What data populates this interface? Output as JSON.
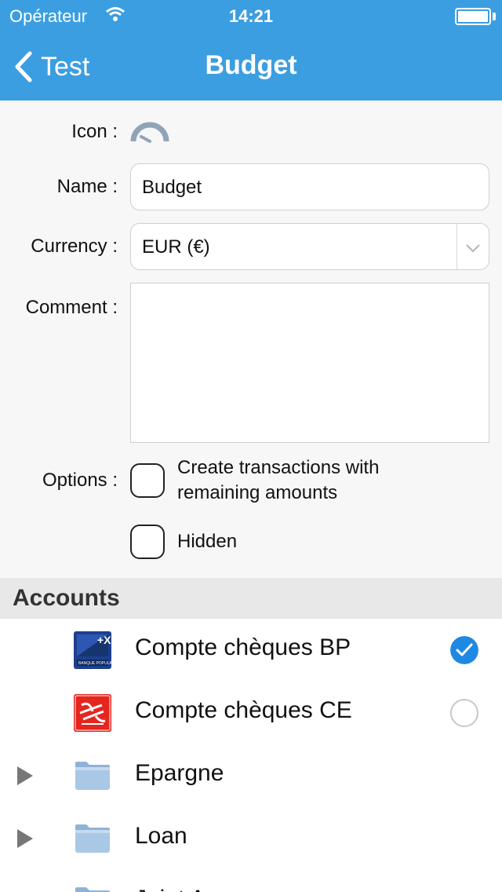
{
  "status_bar": {
    "carrier": "Opérateur",
    "time": "14:21"
  },
  "nav": {
    "back_label": "Test",
    "title": "Budget"
  },
  "form": {
    "icon_label": "Icon :",
    "name_label": "Name :",
    "name_value": "Budget",
    "currency_label": "Currency :",
    "currency_value": "EUR (€)",
    "comment_label": "Comment :",
    "comment_value": "",
    "options_label": "Options :",
    "option_remaining_line1": "Create transactions with",
    "option_remaining_line2": "remaining amounts",
    "option_remaining_checked": false,
    "option_hidden": "Hidden",
    "option_hidden_checked": false
  },
  "accounts": {
    "title": "Accounts",
    "items": [
      {
        "label": "Compte chèques BP",
        "icon": "banque-populaire-logo",
        "selected": true
      },
      {
        "label": "Compte chèques CE",
        "icon": "caisse-epargne-logo",
        "selected": false
      },
      {
        "label": "Epargne",
        "icon": "folder-icon",
        "expandable": true
      },
      {
        "label": "Loan",
        "icon": "folder-icon",
        "expandable": true
      },
      {
        "label": "Joint A...",
        "icon": "folder-icon",
        "expandable": true
      }
    ]
  },
  "colors": {
    "accent": "#3b9ee0",
    "check": "#1e88e5",
    "caisse_red": "#e4261e",
    "bp_blue": "#1d3f8f"
  }
}
